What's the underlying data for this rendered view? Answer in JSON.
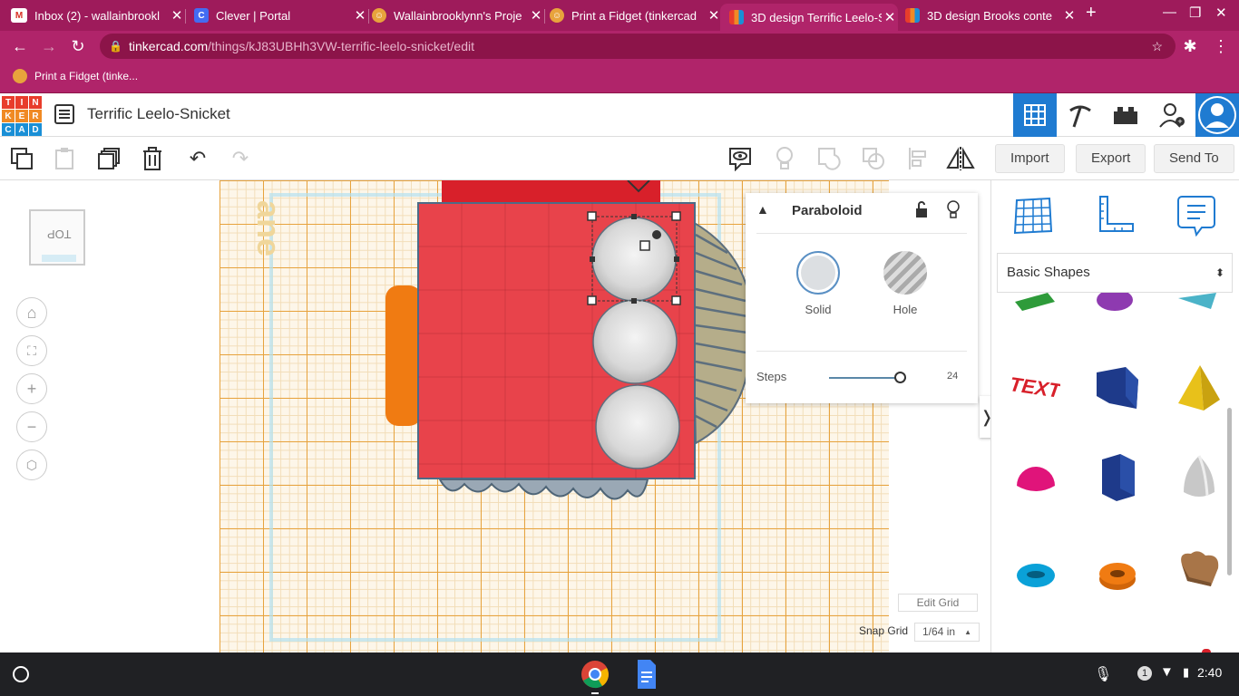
{
  "browser": {
    "tabs": [
      {
        "title": "Inbox (2) - wallainbrookl",
        "icon": "gmail-icon",
        "color": "#d93025",
        "glyph": "M"
      },
      {
        "title": "Clever | Portal",
        "icon": "clever-icon",
        "color": "#436cf2",
        "glyph": "C"
      },
      {
        "title": "Wallainbrooklynn's Proje",
        "icon": "tinkercad-avatar-icon",
        "color": "#e8a33c",
        "glyph": ""
      },
      {
        "title": "Print a Fidget (tinkercad",
        "icon": "tinkercad-avatar-icon",
        "color": "#e8a33c",
        "glyph": ""
      },
      {
        "title": "3D design Terrific Leelo-S",
        "icon": "tinkercad-icon",
        "color": "#1477d1",
        "glyph": ""
      },
      {
        "title": "3D design Brooks conte",
        "icon": "tinkercad-icon",
        "color": "#1477d1",
        "glyph": ""
      }
    ],
    "new_tab": "+",
    "url_domain": "tinkercad.com",
    "url_path": "/things/kJ83UBHh3VW-terrific-leelo-snicket/edit",
    "bookmark": "Print a Fidget (tinke..."
  },
  "app": {
    "logo_letters": [
      "T",
      "I",
      "N",
      "K",
      "E",
      "R",
      "C",
      "A",
      "D"
    ],
    "logo_colors": [
      "#e83d2b",
      "#e83d2b",
      "#e83d2b",
      "#f08a24",
      "#f08a24",
      "#f08a24",
      "#1a8fd6",
      "#1a8fd6",
      "#1a8fd6"
    ],
    "design_title": "Terrific Leelo-Snicket"
  },
  "toolbar": {
    "import_label": "Import",
    "export_label": "Export",
    "send_label": "Send To"
  },
  "viewcube": {
    "label": "TOP"
  },
  "inspector": {
    "shape_name": "Paraboloid",
    "solid_label": "Solid",
    "hole_label": "Hole",
    "steps_label": "Steps",
    "steps_value": "24",
    "steps_fraction": 0.92
  },
  "canvas": {
    "edit_grid_label": "Edit Grid",
    "snap_grid_label": "Snap Grid",
    "snap_grid_value": "1/64 in"
  },
  "shapes_panel": {
    "category": "Basic Shapes"
  },
  "taskbar": {
    "notifications": "1",
    "time": "2:40"
  }
}
